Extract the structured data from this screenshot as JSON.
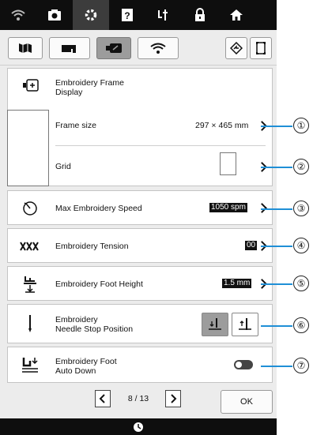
{
  "top_icons": [
    "wifi-icon",
    "camera-icon",
    "settings-icon",
    "help-icon",
    "needle-icon",
    "lock-icon",
    "home-icon"
  ],
  "tabs": [
    "sewing-settings-icon",
    "machine-icon",
    "embroidery-icon",
    "wifi-icon"
  ],
  "frame_display": {
    "title": "Embroidery Frame\nDisplay",
    "frame_size_label": "Frame size",
    "frame_size_value": "297 × 465 mm",
    "grid_label": "Grid"
  },
  "max_speed": {
    "label": "Max Embroidery Speed",
    "value": "1050 spm"
  },
  "tension": {
    "label": "Embroidery Tension",
    "value": "00"
  },
  "foot_height": {
    "label": "Embroidery Foot Height",
    "value": "1.5 mm"
  },
  "needle_stop": {
    "label": "Embroidery\nNeedle Stop Position"
  },
  "foot_auto_down": {
    "label": "Embroidery Foot\nAuto Down",
    "enabled": false
  },
  "pager": {
    "current": "8 / 13"
  },
  "ok_label": "OK",
  "callouts": [
    "①",
    "②",
    "③",
    "④",
    "⑤",
    "⑥",
    "⑦"
  ],
  "colors": {
    "callout_line": "#1f8fd6",
    "topbar": "#0e0e0e",
    "active_tab": "#9c9c9c"
  }
}
